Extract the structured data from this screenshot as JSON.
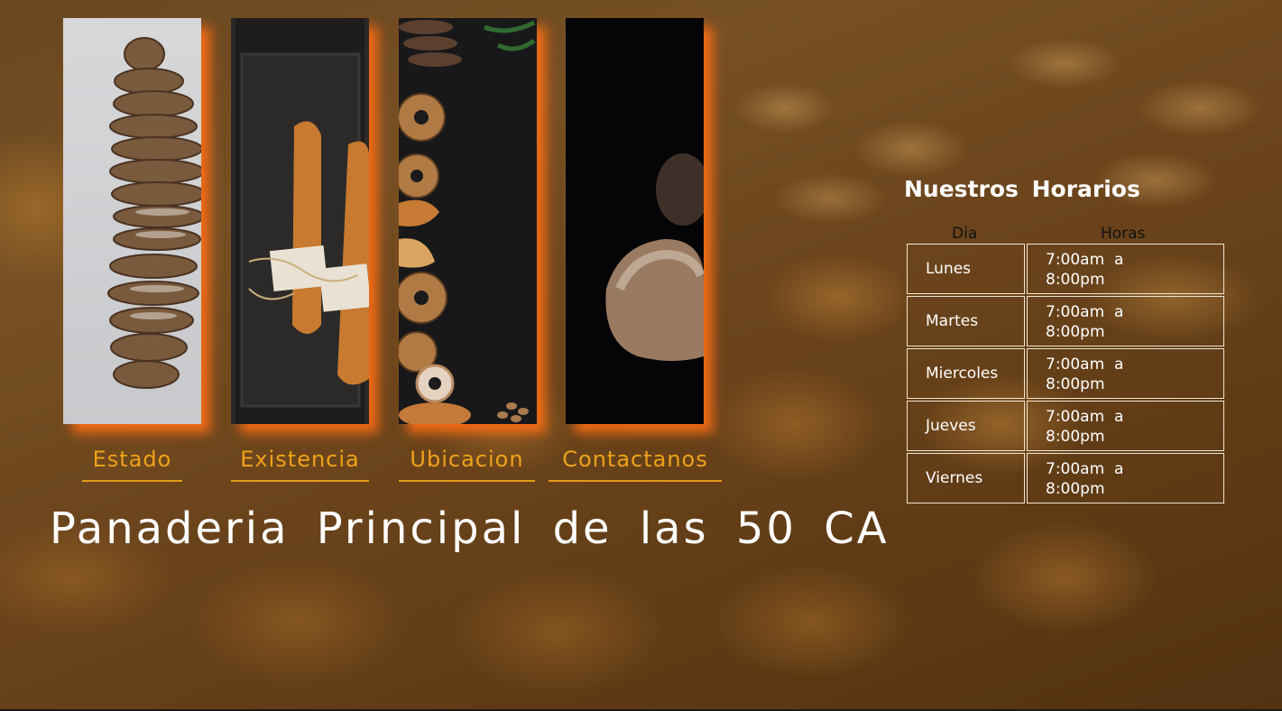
{
  "nav": {
    "items": [
      {
        "label": "Estado"
      },
      {
        "label": "Existencia"
      },
      {
        "label": "Ubicacion"
      },
      {
        "label": "Contactanos"
      }
    ]
  },
  "hero": {
    "title": "Panaderia Principal de las 50 CA"
  },
  "schedule": {
    "title": "Nuestros Horarios",
    "col_day": "Dia",
    "col_hours": "Horas",
    "rows": [
      {
        "day": "Lunes",
        "open": "7:00am  a",
        "close": "8:00pm"
      },
      {
        "day": "Martes",
        "open": "7:00am  a",
        "close": "8:00pm"
      },
      {
        "day": "Miercoles",
        "open": "7:00am  a",
        "close": "8:00pm"
      },
      {
        "day": "Jueves",
        "open": "7:00am  a",
        "close": "8:00pm"
      },
      {
        "day": "Viernes",
        "open": "7:00am  a",
        "close": "8:00pm"
      }
    ]
  },
  "colors": {
    "accent": "#f0a218",
    "card_glow": "#ff6e14",
    "text": "#ffffff"
  }
}
